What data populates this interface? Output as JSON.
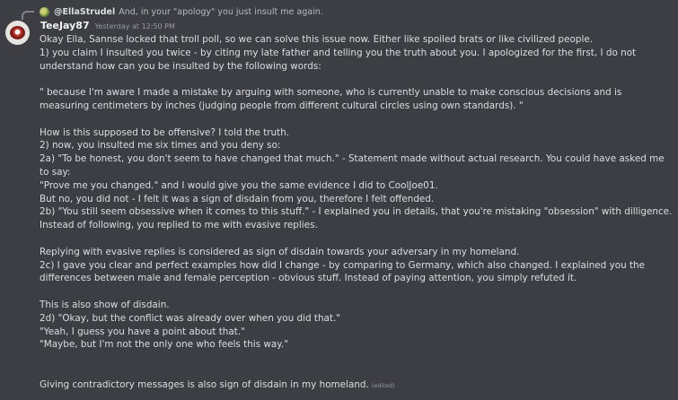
{
  "reply": {
    "author": "@EllaStrudel",
    "text": "And, in your \"apology\" you just insult me again."
  },
  "message": {
    "username": "TeeJay87",
    "timestamp": "Yesterday at 12:50 PM",
    "lines": [
      "Okay Ella, Sannse locked that troll poll, so we can solve this issue now. Either like spoiled brats or like civilized people.",
      "1) you claim I insulted you twice - by citing my late father and telling you the truth about you. I apologized for the first, I do not understand how can you be insulted by the following words:",
      "\" because I'm aware I made a mistake by arguing with someone, who is currently unable to make conscious decisions and is measuring centimeters by inches (judging people from different cultural circles using own standards). \"",
      "How is this supposed to be offensive? I told the truth.",
      "2) now, you insulted me six times and you deny so:",
      "2a) \"To be honest, you don't seem to have changed that much.\" - Statement made without actual research. You could have asked me to say:",
      "\"Prove me you changed.\" and I would give you the same evidence I did to CoolJoe01.",
      "But no, you did not - I felt it was a sign of disdain from you, therefore I felt offended.",
      "2b) \"You still seem obsessive when it comes to this stuff.\" - I explained you in details, that you're mistaking \"obsession\" with dilligence. Instead of following, you replied to me with evasive replies.",
      "Replying with evasive replies is considered as sign of disdain towards your adversary in my homeland.",
      "2c) I gave you clear and perfect examples how did I change - by comparing to Germany, which also changed. I explained you the differences between male and female perception - obvious stuff. Instead of paying attention, you simply refuted it.",
      "This is also show of disdain.",
      "2d) \"Okay, but the conflict was already over when you did that.\"",
      "\"Yeah, I guess you have a point about that.\"",
      "\"Maybe, but I'm not the only one who feels this way.\"",
      "Giving contradictory messages is also sign of disdain in my homeland."
    ],
    "edited_label": "(edited)"
  }
}
